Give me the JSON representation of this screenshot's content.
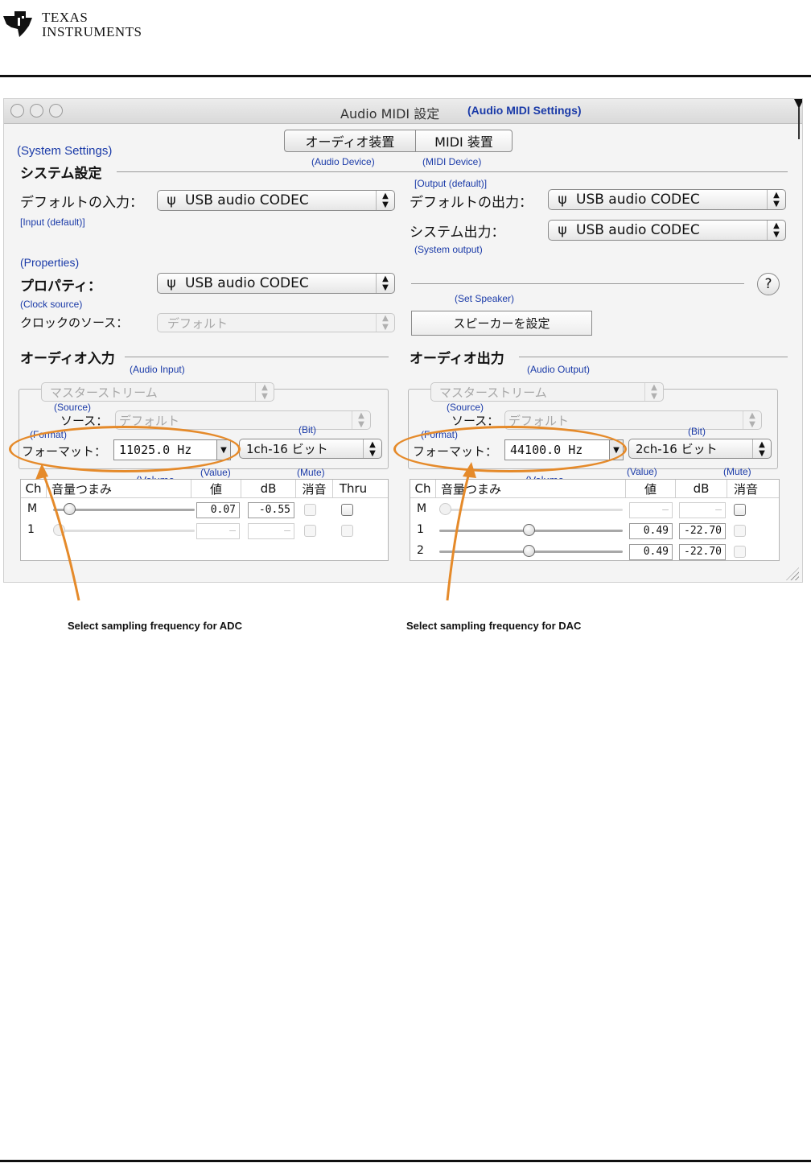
{
  "header": {
    "logo_line1": "TEXAS",
    "logo_line2": "INSTRUMENTS"
  },
  "window": {
    "title": "Audio MIDI 設定",
    "title_en": "(Audio MIDI Settings)",
    "tabs": [
      {
        "label": "オーディオ装置",
        "en": "(Audio Device)",
        "selected": true
      },
      {
        "label": "MIDI 装置",
        "en": "(MIDI Device)",
        "selected": false
      }
    ]
  },
  "system": {
    "section_en": "(System Settings)",
    "section": "システム設定",
    "default_input_label": "デフォルトの入力：",
    "default_input_en": "[Input (default)]",
    "default_input_value": "USB audio CODEC",
    "default_output_en": "[Output (default)]",
    "default_output_label": "デフォルトの出力：",
    "default_output_value": "USB audio CODEC",
    "system_output_label": "システム出力：",
    "system_output_en": "(System output)",
    "system_output_value": "USB audio CODEC"
  },
  "properties": {
    "en": "(Properties)",
    "label": "プロパティ：",
    "value": "USB audio CODEC",
    "help": "?",
    "clock_en": "(Clock source)",
    "clock_label": "クロックのソース：",
    "clock_value": "デフォルト",
    "speaker_en": "(Set Speaker)",
    "speaker_button": "スピーカーを設定"
  },
  "audio_input": {
    "section": "オーディオ入力",
    "section_en": "(Audio Input)",
    "stream": "マスターストリーム",
    "source_en": "(Source)",
    "source_label": "ソース：",
    "source_value": "デフォルト",
    "format_en": "(Format)",
    "format_label": "フォーマット：",
    "format_value": "11025.0 Hz",
    "bit_en": "(Bit)",
    "bit_value": "1ch-16 ビット",
    "columns": {
      "ch": "Ch",
      "vol": "音量つまみ",
      "val": "値",
      "db": "dB",
      "mute": "消音",
      "thru": "Thru"
    },
    "col_en": {
      "vol": "(Volume Control)",
      "val": "(Value)",
      "mute": "(Mute)"
    },
    "rows": [
      {
        "ch": "M",
        "value": "0.07",
        "db": "-0.55",
        "level": 0.08
      },
      {
        "ch": "1",
        "value": "—",
        "db": "—",
        "level": 0.0
      }
    ]
  },
  "audio_output": {
    "section": "オーディオ出力",
    "section_en": "(Audio Output)",
    "stream": "マスターストリーム",
    "source_en": "(Source)",
    "source_label": "ソース：",
    "source_value": "デフォルト",
    "format_en": "(Format)",
    "format_label": "フォーマット：",
    "format_value": "44100.0 Hz",
    "bit_en": "(Bit)",
    "bit_value": "2ch-16 ビット",
    "columns": {
      "ch": "Ch",
      "vol": "音量つまみ",
      "val": "値",
      "db": "dB",
      "mute": "消音"
    },
    "col_en": {
      "vol": "(Volume Control)",
      "val": "(Value)",
      "mute": "(Mute)"
    },
    "rows": [
      {
        "ch": "M",
        "value": "—",
        "db": "—",
        "level": 0.0
      },
      {
        "ch": "1",
        "value": "0.49",
        "db": "-22.70",
        "level": 0.49
      },
      {
        "ch": "2",
        "value": "0.49",
        "db": "-22.70",
        "level": 0.49
      }
    ]
  },
  "captions": {
    "adc": "Select sampling frequency for ADC",
    "dac": "Select sampling frequency for DAC"
  }
}
